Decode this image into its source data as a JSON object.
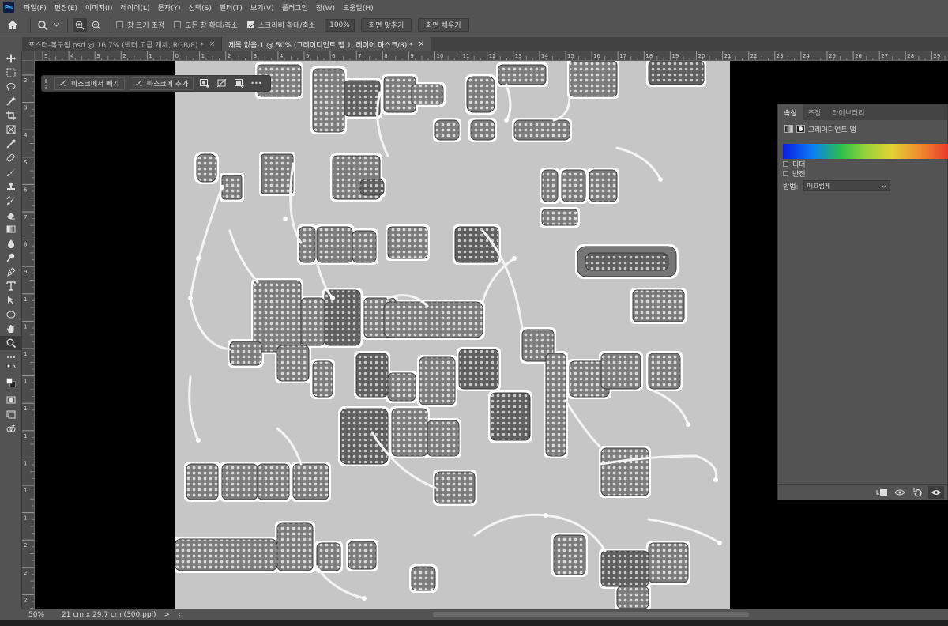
{
  "app": {
    "logo": "Ps"
  },
  "menu": [
    "파일(F)",
    "편집(E)",
    "이미지(I)",
    "레이어(L)",
    "문자(Y)",
    "선택(S)",
    "필터(T)",
    "보기(V)",
    "플러그인",
    "창(W)",
    "도움말(H)"
  ],
  "options": {
    "resize_windows": "창 크기 조정",
    "resize_windows_checked": false,
    "zoom_all_windows": "모든 창 확대/축소",
    "zoom_all_windows_checked": false,
    "scrubby_zoom": "스크러비 확대/축소",
    "scrubby_zoom_checked": true,
    "zoom_value": "100%",
    "fit_screen": "화면 맞추기",
    "fill_screen": "화면 채우기"
  },
  "tabs": [
    {
      "label": "포스터-복구됨.psd @ 16.7% (벡터 고급 개체, RGB/8) *",
      "close": "×",
      "active": false
    },
    {
      "label": "제목 없음-1 @ 50% (그레이디언트 맵 1, 레이어 마스크/8) *",
      "close": "×",
      "active": true
    }
  ],
  "rulers": {
    "top": [
      "5",
      "4",
      "3",
      "2",
      "1",
      "0",
      "1",
      "2",
      "3",
      "4",
      "5",
      "6",
      "7",
      "8",
      "9",
      "10",
      "11",
      "12",
      "13",
      "14",
      "15",
      "16",
      "17",
      "18",
      "19",
      "20",
      "21",
      "22",
      "23",
      "24",
      "25",
      "26",
      "27",
      "28",
      "29"
    ],
    "left": [
      "2",
      "3",
      "4",
      "5",
      "6",
      "7",
      "8",
      "9",
      "1",
      "1",
      "1",
      "1",
      "1",
      "1",
      "1",
      "1",
      "1",
      "2",
      "2",
      "2"
    ]
  },
  "taskbar": {
    "subtract": "마스크에서 빼기",
    "add": "마스크에 추가",
    "more": "•••"
  },
  "properties": {
    "tabs": [
      "속성",
      "조정",
      "라이브러리"
    ],
    "active_tab": "속성",
    "header": "그레이디언트 맵",
    "dither": "디더",
    "reverse": "반전",
    "method_label": "방법:",
    "method_value": "매끄럽게",
    "gradient_colors": [
      "#0a1de5",
      "#0a7ff0",
      "#2ec04a",
      "#9bd23a",
      "#e3d234",
      "#ef8b2d",
      "#e6342a"
    ]
  },
  "status": {
    "zoom": "50%",
    "doc_info": "21 cm x 29.7 cm (300 ppi)",
    "arrow": ">",
    "back": "‹"
  },
  "colors": {
    "ui_bg": "#535353",
    "canvas_bg": "#c6c6c6",
    "pasteboard": "#000000"
  }
}
